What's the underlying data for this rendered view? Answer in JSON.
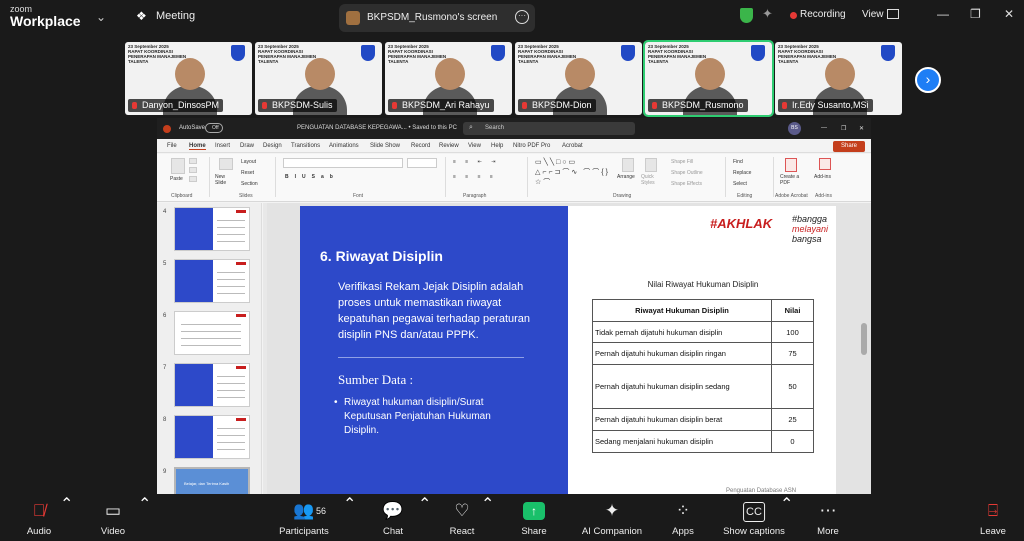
{
  "topbar": {
    "logo_small": "zoom",
    "logo_big": "Workplace",
    "meeting_label": "Meeting",
    "screen_title": "BKPSDM_Rusmono's screen",
    "recording_label": "Recording",
    "view_label": "View"
  },
  "participants": [
    {
      "name": "Danyon_DinsosPM"
    },
    {
      "name": "BKPSDM-Sulis"
    },
    {
      "name": "BKPSDM_Ari Rahayu"
    },
    {
      "name": "BKPSDM-Dion"
    },
    {
      "name": "BKPSDM_Rusmono"
    },
    {
      "name": "Ir.Edy Susanto,MSi"
    }
  ],
  "tile_header": {
    "date": "23 September 2025",
    "line1": "RAPAT KOORDINASI",
    "line2": "PENERAPAN MANAJEMEN",
    "line3": "TALENTA"
  },
  "ppt": {
    "autosave": "AutoSave",
    "autosave_state": "Off",
    "doc_title": "PENGUATAN DATABASE KEPEGAWA... • Saved to this PC",
    "search_placeholder": "Search",
    "user_initials": "BS",
    "menu": [
      "File",
      "Home",
      "Insert",
      "Draw",
      "Design",
      "Transitions",
      "Animations",
      "Slide Show",
      "Record",
      "Review",
      "View",
      "Help",
      "Nitro PDF Pro",
      "Acrobat"
    ],
    "share_label": "Share",
    "ribbon": {
      "paste": "Paste",
      "new_slide": "New Slide",
      "layout": "Layout",
      "reset": "Reset",
      "section": "Section",
      "arrange": "Arrange",
      "quick_styles": "Quick Styles",
      "shape_fill": "Shape Fill",
      "shape_outline": "Shape Outline",
      "shape_effects": "Shape Effects",
      "find": "Find",
      "replace": "Replace",
      "select": "Select",
      "create_pdf": "Create a PDF",
      "addins": "Add-ins",
      "groups": [
        "Clipboard",
        "Slides",
        "Font",
        "Paragraph",
        "Drawing",
        "Editing",
        "Adobe Acrobat",
        "Add-ins"
      ]
    },
    "thumb_numbers": [
      "4",
      "5",
      "6",
      "7",
      "8",
      "9"
    ],
    "thumb9_text": "Belajar, dan Terima Kasih"
  },
  "slide": {
    "title": "6. Riwayat Disiplin",
    "body": "Verifikasi Rekam Jejak Disiplin adalah proses untuk memastikan riwayat kepatuhan pegawai terhadap peraturan disiplin PNS dan/atau PPPK.",
    "source_heading": "Sumber Data :",
    "bullet": "Riwayat hukuman disiplin/Surat Keputusan Penjatuhan Hukuman Disiplin.",
    "brand_akhlak": "#AKHLAK",
    "brand_bangga": "#bangga",
    "brand_melayani": "melayani",
    "brand_bangsa": "bangsa",
    "table_caption": "Nilai Riwayat Hukuman Disiplin",
    "table_headers": [
      "Riwayat Hukuman Disiplin",
      "Nilai"
    ],
    "table_rows": [
      [
        "Tidak pernah dijatuhi hukuman disiplin",
        "100"
      ],
      [
        "Pernah dijatuhi hukuman disiplin ringan",
        "75"
      ],
      [
        "Pernah dijatuhi hukuman disiplin sedang",
        "50"
      ],
      [
        "Pernah dijatuhi hukuman disiplin berat",
        "25"
      ],
      [
        "Sedang menjalani hukuman disiplin",
        "0"
      ]
    ],
    "footer": "Penguatan Database ASN"
  },
  "toolbar": {
    "audio": "Audio",
    "video": "Video",
    "participants": "Participants",
    "participant_count": "56",
    "chat": "Chat",
    "react": "React",
    "share": "Share",
    "ai_companion": "AI Companion",
    "apps": "Apps",
    "show_captions": "Show captions",
    "more": "More",
    "leave": "Leave"
  },
  "colors": {
    "slide_blue": "#2d49c9",
    "brand_red": "#c81e1e",
    "share_green": "#19c06a",
    "active_speaker": "#2ecc71",
    "recording_red": "#e53935"
  }
}
